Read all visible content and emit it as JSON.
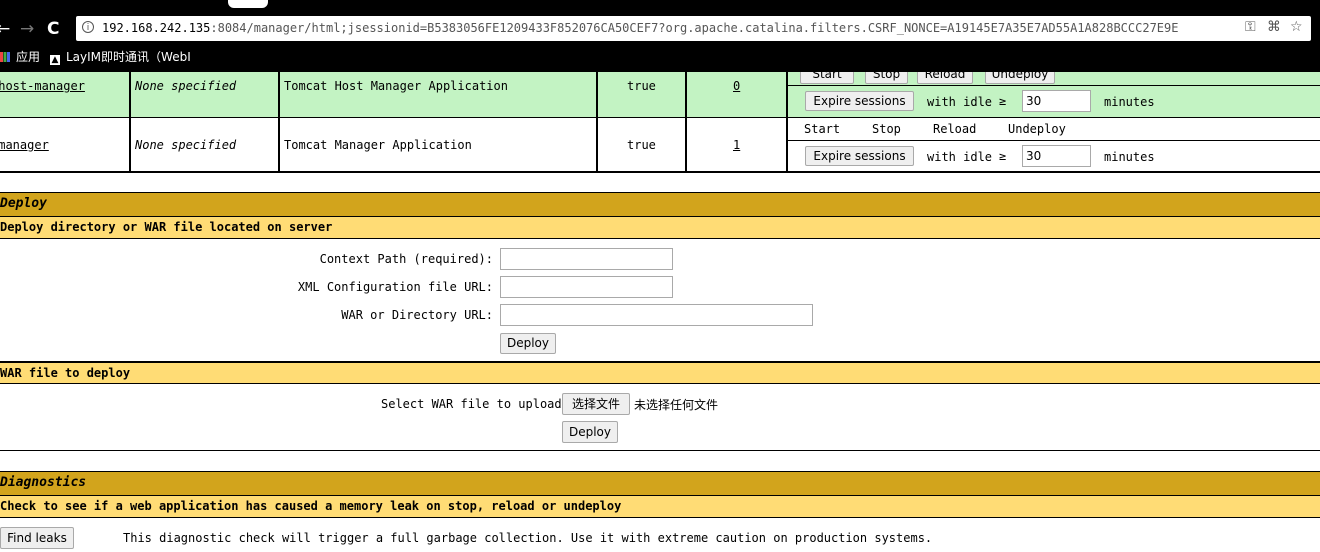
{
  "browser": {
    "back": "←",
    "forward": "→",
    "reload": "C",
    "info_icon": "i",
    "url_host": "192.168.242.135",
    "url_rest": ":8084/manager/html;jsessionid=B5383056FE1209433F852076CA50CEF7?org.apache.catalina.filters.CSRF_NONCE=A19145E7A35E7AD55A1A828BCCC27E9E",
    "bookmarks": [
      {
        "label": "应用",
        "icon": "apps-grid-icon"
      },
      {
        "label": "LayIM即时通讯（WebI",
        "icon": "layim-icon"
      }
    ]
  },
  "apps": [
    {
      "path": "/host-manager",
      "version": "None specified",
      "display_name": "Tomcat Host Manager Application",
      "running": "true",
      "sessions": "0",
      "commands": [
        "Start",
        "Stop",
        "Reload",
        "Undeploy"
      ],
      "expire_label": "Expire sessions",
      "idle_label": "with idle",
      "idle_op": "≥",
      "idle_value": "30",
      "minutes_label": "minutes"
    },
    {
      "path": "/manager",
      "version": "None specified",
      "display_name": "Tomcat Manager Application",
      "running": "true",
      "sessions": "1",
      "commands": [
        "Start",
        "Stop",
        "Reload",
        "Undeploy"
      ],
      "expire_label": "Expire sessions",
      "idle_label": "with idle",
      "idle_op": "≥",
      "idle_value": "30",
      "minutes_label": "minutes"
    }
  ],
  "deploy": {
    "title": "Deploy",
    "server_subtitle": "Deploy directory or WAR file located on server",
    "context_label": "Context Path (required):",
    "xml_label": "XML Configuration file URL:",
    "war_label": "WAR or Directory URL:",
    "context_value": "",
    "xml_value": "",
    "war_value": "",
    "deploy_button": "Deploy",
    "upload_subtitle": "WAR file to deploy",
    "select_label": "Select WAR file to upload",
    "choose_button": "选择文件",
    "no_file_text": "未选择任何文件",
    "upload_deploy_button": "Deploy"
  },
  "diagnostics": {
    "title": "Diagnostics",
    "subtitle": "Check to see if a web application has caused a memory leak on stop, reload or undeploy",
    "find_leaks_button": "Find leaks",
    "description": "This diagnostic check will trigger a full garbage collection. Use it with extreme caution on production systems."
  }
}
